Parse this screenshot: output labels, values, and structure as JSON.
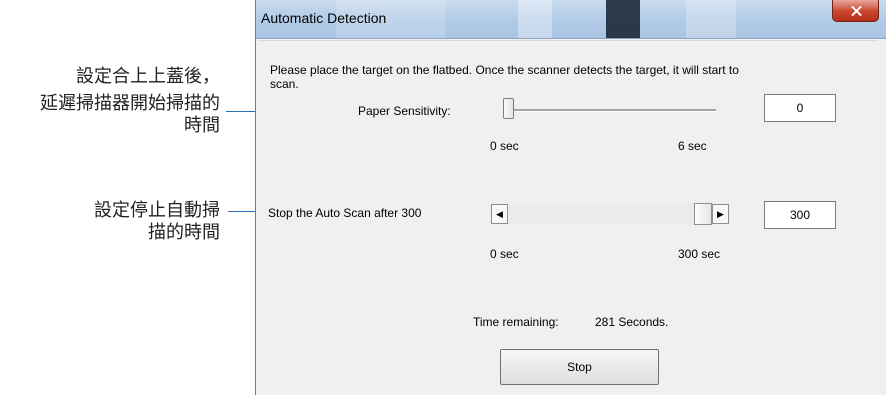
{
  "callouts": {
    "sensitivity": {
      "line1": "設定合上上蓋後，",
      "line2": "延遲掃描器開始掃描的",
      "line3": "時間"
    },
    "stop_after": {
      "line1": "設定停止自動掃",
      "line2": "描的時間"
    }
  },
  "dialog": {
    "title": "Automatic Detection",
    "instruction_line1": "Please place the target on the flatbed. Once the scanner detects the target, it will start to",
    "instruction_line2": "scan.",
    "paper_sensitivity": {
      "label": "Paper Sensitivity:",
      "value": "0",
      "min_label": "0  sec",
      "max_label": "6  sec",
      "level_fraction": 0.0
    },
    "auto_scan": {
      "label": "Stop the Auto Scan after 300",
      "value": "300",
      "min_label": "0 sec",
      "max_label": "300 sec",
      "left_arrow": "◀",
      "right_arrow": "▶",
      "level_fraction": 1.0
    },
    "time_remaining_label": "Time remaining:",
    "time_remaining_value": "281 Seconds.",
    "stop_button": "Stop"
  },
  "colors": {
    "leader": "#2b6fb4",
    "titlebar": "#b4cde8",
    "close_button": "#c9452f",
    "dialog_bg": "#f0f0f0"
  }
}
